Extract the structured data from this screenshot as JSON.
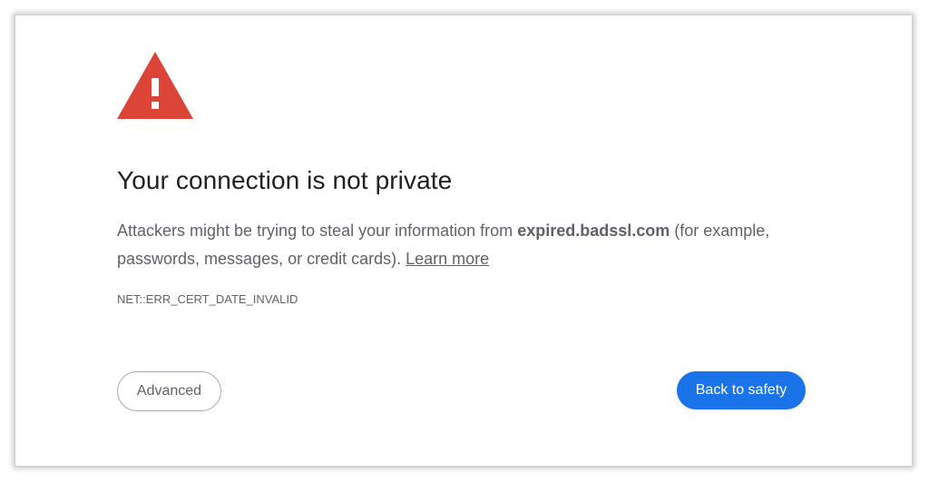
{
  "page": {
    "heading": "Your connection is not private",
    "message": {
      "before_host": "Attackers might be trying to steal your information from ",
      "host": "expired.badssl.com",
      "after_host": " (for example, passwords, messages, or credit cards). ",
      "learn_more": "Learn more"
    },
    "error_code": "NET::ERR_CERT_DATE_INVALID"
  },
  "buttons": {
    "advanced": "Advanced",
    "back_to_safety": "Back to safety"
  },
  "icons": {
    "warning": "warning-triangle-icon"
  },
  "colors": {
    "warning_red": "#db4437",
    "primary_blue": "#1a73e8",
    "heading_text": "#202124",
    "body_text": "#5f6368"
  }
}
